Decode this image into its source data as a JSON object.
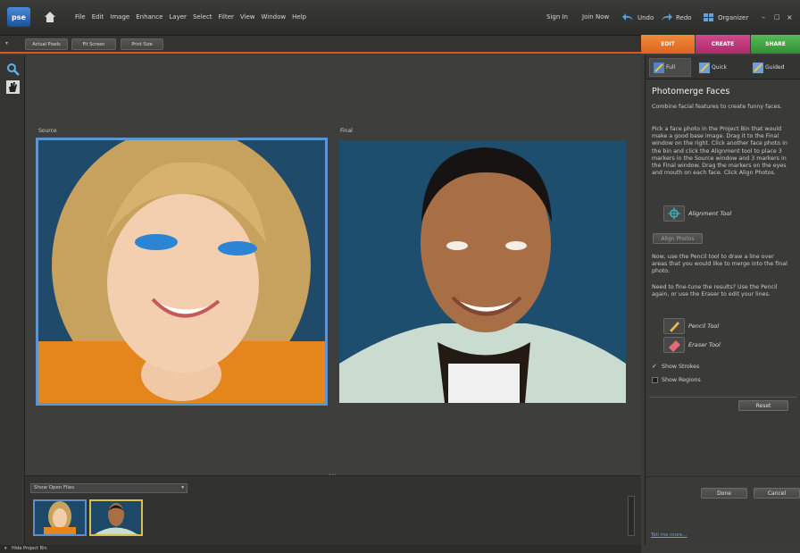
{
  "app": {
    "logo": "pse"
  },
  "menu": [
    "File",
    "Edit",
    "Image",
    "Enhance",
    "Layer",
    "Select",
    "Filter",
    "View",
    "Window",
    "Help"
  ],
  "top_right": {
    "sign_in": "Sign In",
    "join_now": "Join Now",
    "undo": "Undo",
    "redo": "Redo",
    "organizer": "Organizer"
  },
  "toolbar": {
    "actual_pixels": "Actual Pixels",
    "fit_screen": "Fit Screen",
    "print_size": "Print Size"
  },
  "modes": {
    "edit": "EDIT",
    "create": "CREATE",
    "share": "SHARE"
  },
  "canvas": {
    "source_label": "Source",
    "final_label": "Final"
  },
  "bin": {
    "show_label": "Show Open Files",
    "status": "Hide Project Bin"
  },
  "panel": {
    "tabs": [
      "Full",
      "Quick",
      "Guided"
    ],
    "title": "Photomerge Faces",
    "intro": "Combine facial features to create funny faces.",
    "instructions": "Pick a face photo in the Project Bin that would make a good base image. Drag it to the Final window on the right. Click another face photo in the bin and click the Alignment tool to place 3 markers in the Source window and 3 markers in the Final window. Drag the markers on the eyes and mouth on each face. Click Align Photos.",
    "alignment_tool": "Alignment Tool",
    "align_photos": "Align Photos",
    "pencil_instructions": "Now, use the Pencil tool to draw a line over areas that you would like to merge into the final photo.",
    "finetune": "Need to fine-tune the results? Use the Pencil again, or use the Eraser to edit your lines.",
    "pencil_tool": "Pencil Tool",
    "eraser_tool": "Eraser Tool",
    "show_strokes": "Show Strokes",
    "show_regions": "Show Regions",
    "reset": "Reset",
    "done": "Done",
    "cancel": "Cancel",
    "tell_me_more": "Tell me more..."
  },
  "colors": {
    "edit": "#e8702a",
    "create": "#c2327b",
    "share": "#3ba33f",
    "accent": "#d45a22"
  }
}
